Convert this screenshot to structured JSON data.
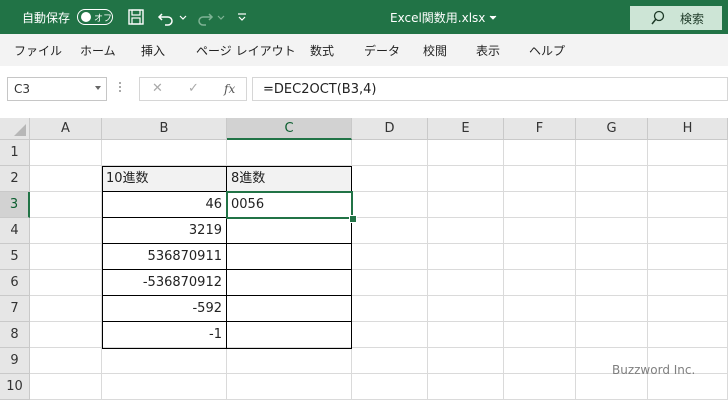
{
  "titlebar": {
    "autosave_label": "自動保存",
    "autosave_state": "オフ",
    "document_title": "Excel関数用.xlsx",
    "search_label": "検索"
  },
  "menu": [
    "ファイル",
    "ホーム",
    "挿入",
    "ページ レイアウト",
    "数式",
    "データ",
    "校閲",
    "表示",
    "ヘルプ"
  ],
  "formula_bar": {
    "name_box": "C3",
    "cancel_symbol": "✕",
    "enter_symbol": "✓",
    "fx_symbol": "fx",
    "formula": "=DEC2OCT(B3,4)"
  },
  "sheet": {
    "columns": [
      "A",
      "B",
      "C",
      "D",
      "E",
      "F",
      "G",
      "H"
    ],
    "rows": [
      "1",
      "2",
      "3",
      "4",
      "5",
      "6",
      "7",
      "8",
      "9",
      "10"
    ],
    "selected_cell": "C3",
    "headers": {
      "b": "10進数",
      "c": "8進数"
    },
    "data": [
      {
        "b": "46",
        "c": "0056"
      },
      {
        "b": "3219",
        "c": ""
      },
      {
        "b": "536870911",
        "c": ""
      },
      {
        "b": "-536870912",
        "c": ""
      },
      {
        "b": "-592",
        "c": ""
      },
      {
        "b": "-1",
        "c": ""
      }
    ]
  },
  "watermark": "Buzzword Inc.",
  "colors": {
    "accent": "#217346",
    "search_bg": "#cde5d6",
    "header_bg": "#e6e6e6"
  }
}
